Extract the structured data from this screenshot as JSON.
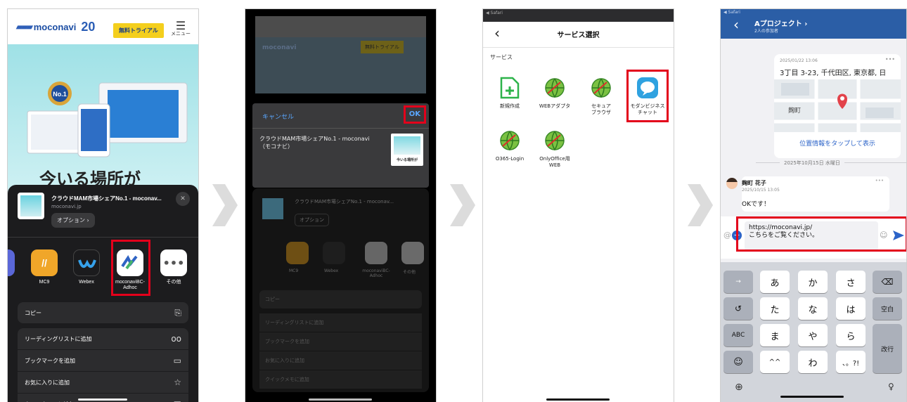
{
  "step1": {
    "logo_text": "moconavi",
    "logo_badge": "20",
    "trial_label": "無料トライアル",
    "menu_label": "メニュー",
    "hero_text": "今いる場所が",
    "share": {
      "title": "クラウドMAM市場シェアNo.1 - moconav...",
      "domain": "moconavi.jp",
      "options_label": "オプション",
      "close_glyph": "✕",
      "apps": [
        {
          "label": "MC9"
        },
        {
          "label": "Webex"
        },
        {
          "label": "moconaviBC-\nAdhoc"
        },
        {
          "label": "その他"
        }
      ],
      "actions": [
        {
          "label": "コピー",
          "icon": "copy-icon"
        },
        {
          "label": "リーディングリストに追加",
          "icon": "glasses-icon"
        },
        {
          "label": "ブックマークを追加",
          "icon": "book-icon"
        },
        {
          "label": "お気に入りに追加",
          "icon": "star-icon"
        },
        {
          "label": "クイックメモに追加",
          "icon": "memo-icon"
        }
      ]
    }
  },
  "step2": {
    "cancel_label": "キャンセル",
    "ok_label": "OK",
    "post_text": "クラウドMAM市場シェアNo.1 - moconavi\n（モコナビ）",
    "thumb_caption": "今いる場所が"
  },
  "step3": {
    "status_label": "◀ Safari",
    "back_glyph": "‹",
    "title": "サービス選択",
    "section_label": "サービス",
    "services": [
      {
        "label": "新規作成",
        "icon": "new-document-icon"
      },
      {
        "label": "WEBアダプタ",
        "icon": "globe-icon"
      },
      {
        "label": "セキュア\nブラウザ",
        "icon": "globe-icon"
      },
      {
        "label": "モダンビジネス\nチャット",
        "icon": "chat-bubble-icon"
      },
      {
        "label": "O365-Login",
        "icon": "globe-icon"
      },
      {
        "label": "OnlyOffice用\nWEB",
        "icon": "globe-icon"
      }
    ]
  },
  "step4": {
    "status_label": "◀ Safari",
    "back_glyph": "‹",
    "chat_title": "Aプロジェクト",
    "chat_sub": "2人の参加者",
    "map_time": "2025/01/22 13:06",
    "map_address": "3丁目 3-23, 千代田区, 東京都, 日",
    "map_link": "位置情報をタップして表示",
    "map_label": "麹町",
    "date_divider": "2025年10月15日 水曜日",
    "sender": "麹町 花子",
    "sender_time": "2025/10/15 13:05",
    "message": "OKです！",
    "input_line1": "https://moconavi.jp/",
    "input_line2": "こちらをご覧ください。",
    "keys": [
      [
        "→",
        "あ",
        "か",
        "さ",
        "⌫"
      ],
      [
        "↺",
        "た",
        "な",
        "は",
        "空白"
      ],
      [
        "ABC",
        "ま",
        "や",
        "ら",
        "改行"
      ],
      [
        "☺",
        "^^",
        "わ",
        "、。?!"
      ]
    ]
  }
}
